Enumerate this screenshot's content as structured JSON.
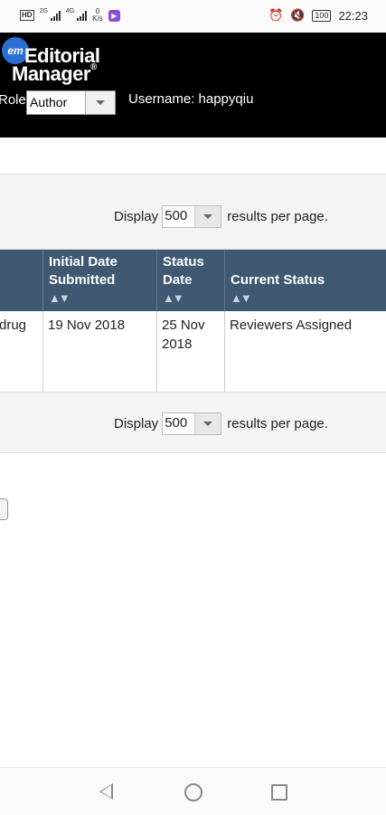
{
  "status_bar": {
    "hd": "HD",
    "net1": "2G",
    "net2": "4G",
    "speed_value": "0",
    "speed_unit": "K/s",
    "battery": "100",
    "time": "22:23"
  },
  "header": {
    "logo_badge": "em",
    "logo_line1": "Editorial",
    "logo_line2": "Manager",
    "logo_reg": "®",
    "role_label": "Role:",
    "role_value": "Author",
    "username": "Username: happyqiu"
  },
  "pagination_top": {
    "display_label": "Display",
    "per_page": "500",
    "suffix": "results per page."
  },
  "table": {
    "columns": [
      {
        "label": "Initial Date Submitted",
        "sort": "▲▼"
      },
      {
        "label": "Status Date",
        "sort": "▲▼"
      },
      {
        "label": "Current Status",
        "sort": "▲▼"
      }
    ],
    "rows": [
      {
        "title_fragment": "drug",
        "initial_date": "19 Nov 2018",
        "status_date": "25 Nov 2018",
        "current_status": "Reviewers Assigned"
      }
    ]
  },
  "pagination_bottom": {
    "display_label": "Display",
    "per_page": "500",
    "suffix": "results per page."
  }
}
